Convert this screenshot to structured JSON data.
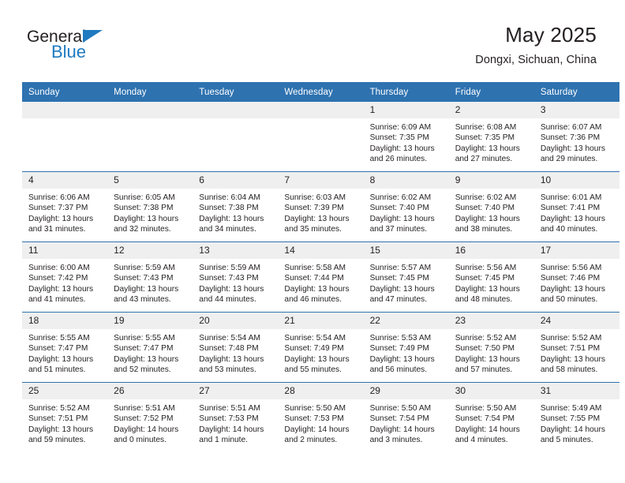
{
  "brand": {
    "name_top": "General",
    "name_bottom": "Blue",
    "triangle_icon": "triangle-icon",
    "accent_color": "#1f7ac0"
  },
  "header": {
    "title": "May 2025",
    "subtitle": "Dongxi, Sichuan, China"
  },
  "theme": {
    "header_blue": "#2e72b0",
    "daynum_band": "#efefef",
    "text": "#231f20"
  },
  "weekday_headers": [
    "Sunday",
    "Monday",
    "Tuesday",
    "Wednesday",
    "Thursday",
    "Friday",
    "Saturday"
  ],
  "weeks": [
    [
      {
        "day": "",
        "lines": []
      },
      {
        "day": "",
        "lines": []
      },
      {
        "day": "",
        "lines": []
      },
      {
        "day": "",
        "lines": []
      },
      {
        "day": "1",
        "lines": [
          "Sunrise: 6:09 AM",
          "Sunset: 7:35 PM",
          "Daylight: 13 hours",
          "and 26 minutes."
        ]
      },
      {
        "day": "2",
        "lines": [
          "Sunrise: 6:08 AM",
          "Sunset: 7:35 PM",
          "Daylight: 13 hours",
          "and 27 minutes."
        ]
      },
      {
        "day": "3",
        "lines": [
          "Sunrise: 6:07 AM",
          "Sunset: 7:36 PM",
          "Daylight: 13 hours",
          "and 29 minutes."
        ]
      }
    ],
    [
      {
        "day": "4",
        "lines": [
          "Sunrise: 6:06 AM",
          "Sunset: 7:37 PM",
          "Daylight: 13 hours",
          "and 31 minutes."
        ]
      },
      {
        "day": "5",
        "lines": [
          "Sunrise: 6:05 AM",
          "Sunset: 7:38 PM",
          "Daylight: 13 hours",
          "and 32 minutes."
        ]
      },
      {
        "day": "6",
        "lines": [
          "Sunrise: 6:04 AM",
          "Sunset: 7:38 PM",
          "Daylight: 13 hours",
          "and 34 minutes."
        ]
      },
      {
        "day": "7",
        "lines": [
          "Sunrise: 6:03 AM",
          "Sunset: 7:39 PM",
          "Daylight: 13 hours",
          "and 35 minutes."
        ]
      },
      {
        "day": "8",
        "lines": [
          "Sunrise: 6:02 AM",
          "Sunset: 7:40 PM",
          "Daylight: 13 hours",
          "and 37 minutes."
        ]
      },
      {
        "day": "9",
        "lines": [
          "Sunrise: 6:02 AM",
          "Sunset: 7:40 PM",
          "Daylight: 13 hours",
          "and 38 minutes."
        ]
      },
      {
        "day": "10",
        "lines": [
          "Sunrise: 6:01 AM",
          "Sunset: 7:41 PM",
          "Daylight: 13 hours",
          "and 40 minutes."
        ]
      }
    ],
    [
      {
        "day": "11",
        "lines": [
          "Sunrise: 6:00 AM",
          "Sunset: 7:42 PM",
          "Daylight: 13 hours",
          "and 41 minutes."
        ]
      },
      {
        "day": "12",
        "lines": [
          "Sunrise: 5:59 AM",
          "Sunset: 7:43 PM",
          "Daylight: 13 hours",
          "and 43 minutes."
        ]
      },
      {
        "day": "13",
        "lines": [
          "Sunrise: 5:59 AM",
          "Sunset: 7:43 PM",
          "Daylight: 13 hours",
          "and 44 minutes."
        ]
      },
      {
        "day": "14",
        "lines": [
          "Sunrise: 5:58 AM",
          "Sunset: 7:44 PM",
          "Daylight: 13 hours",
          "and 46 minutes."
        ]
      },
      {
        "day": "15",
        "lines": [
          "Sunrise: 5:57 AM",
          "Sunset: 7:45 PM",
          "Daylight: 13 hours",
          "and 47 minutes."
        ]
      },
      {
        "day": "16",
        "lines": [
          "Sunrise: 5:56 AM",
          "Sunset: 7:45 PM",
          "Daylight: 13 hours",
          "and 48 minutes."
        ]
      },
      {
        "day": "17",
        "lines": [
          "Sunrise: 5:56 AM",
          "Sunset: 7:46 PM",
          "Daylight: 13 hours",
          "and 50 minutes."
        ]
      }
    ],
    [
      {
        "day": "18",
        "lines": [
          "Sunrise: 5:55 AM",
          "Sunset: 7:47 PM",
          "Daylight: 13 hours",
          "and 51 minutes."
        ]
      },
      {
        "day": "19",
        "lines": [
          "Sunrise: 5:55 AM",
          "Sunset: 7:47 PM",
          "Daylight: 13 hours",
          "and 52 minutes."
        ]
      },
      {
        "day": "20",
        "lines": [
          "Sunrise: 5:54 AM",
          "Sunset: 7:48 PM",
          "Daylight: 13 hours",
          "and 53 minutes."
        ]
      },
      {
        "day": "21",
        "lines": [
          "Sunrise: 5:54 AM",
          "Sunset: 7:49 PM",
          "Daylight: 13 hours",
          "and 55 minutes."
        ]
      },
      {
        "day": "22",
        "lines": [
          "Sunrise: 5:53 AM",
          "Sunset: 7:49 PM",
          "Daylight: 13 hours",
          "and 56 minutes."
        ]
      },
      {
        "day": "23",
        "lines": [
          "Sunrise: 5:52 AM",
          "Sunset: 7:50 PM",
          "Daylight: 13 hours",
          "and 57 minutes."
        ]
      },
      {
        "day": "24",
        "lines": [
          "Sunrise: 5:52 AM",
          "Sunset: 7:51 PM",
          "Daylight: 13 hours",
          "and 58 minutes."
        ]
      }
    ],
    [
      {
        "day": "25",
        "lines": [
          "Sunrise: 5:52 AM",
          "Sunset: 7:51 PM",
          "Daylight: 13 hours",
          "and 59 minutes."
        ]
      },
      {
        "day": "26",
        "lines": [
          "Sunrise: 5:51 AM",
          "Sunset: 7:52 PM",
          "Daylight: 14 hours",
          "and 0 minutes."
        ]
      },
      {
        "day": "27",
        "lines": [
          "Sunrise: 5:51 AM",
          "Sunset: 7:53 PM",
          "Daylight: 14 hours",
          "and 1 minute."
        ]
      },
      {
        "day": "28",
        "lines": [
          "Sunrise: 5:50 AM",
          "Sunset: 7:53 PM",
          "Daylight: 14 hours",
          "and 2 minutes."
        ]
      },
      {
        "day": "29",
        "lines": [
          "Sunrise: 5:50 AM",
          "Sunset: 7:54 PM",
          "Daylight: 14 hours",
          "and 3 minutes."
        ]
      },
      {
        "day": "30",
        "lines": [
          "Sunrise: 5:50 AM",
          "Sunset: 7:54 PM",
          "Daylight: 14 hours",
          "and 4 minutes."
        ]
      },
      {
        "day": "31",
        "lines": [
          "Sunrise: 5:49 AM",
          "Sunset: 7:55 PM",
          "Daylight: 14 hours",
          "and 5 minutes."
        ]
      }
    ]
  ]
}
